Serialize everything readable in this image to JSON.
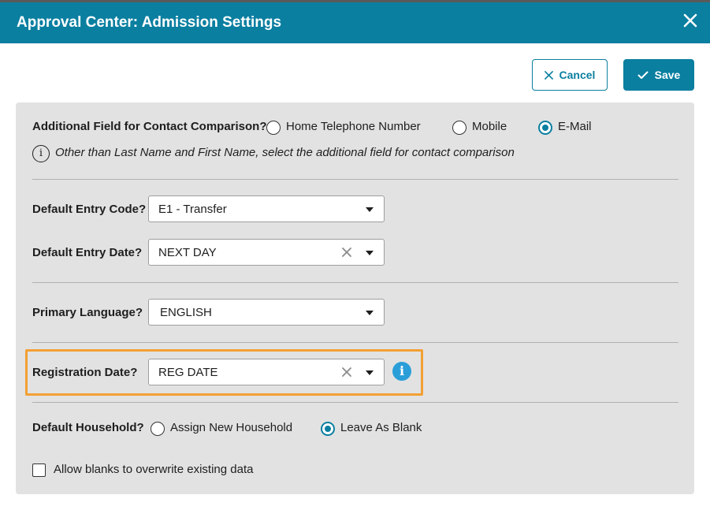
{
  "dialog": {
    "title": "Approval Center: Admission Settings",
    "close_icon": "close-icon",
    "cancel_label": "Cancel",
    "save_label": "Save"
  },
  "contact_comparison": {
    "label": "Additional Field for Contact Comparison?",
    "options": [
      "Home Telephone Number",
      "Mobile",
      "E-Mail"
    ],
    "selected": "E-Mail",
    "help_text": "Other than Last Name and First Name, select the additional field for contact comparison"
  },
  "entry_code": {
    "label": "Default Entry Code?",
    "value": "E1 - Transfer"
  },
  "entry_date": {
    "label": "Default Entry Date?",
    "value": "NEXT DAY"
  },
  "primary_language": {
    "label": "Primary Language?",
    "value": "ENGLISH"
  },
  "registration_date": {
    "label": "Registration Date?",
    "value": "REG DATE",
    "info_icon": "info-icon",
    "highlight_color": "#f2a034"
  },
  "household": {
    "label": "Default Household?",
    "options": [
      "Assign New Household",
      "Leave As Blank"
    ],
    "selected": "Leave As Blank"
  },
  "allow_blanks": {
    "label": "Allow blanks to overwrite existing data",
    "checked": false
  },
  "colors": {
    "accent": "#0a7fa0",
    "panel": "#e2e2e2",
    "info": "#2a9ed8"
  }
}
